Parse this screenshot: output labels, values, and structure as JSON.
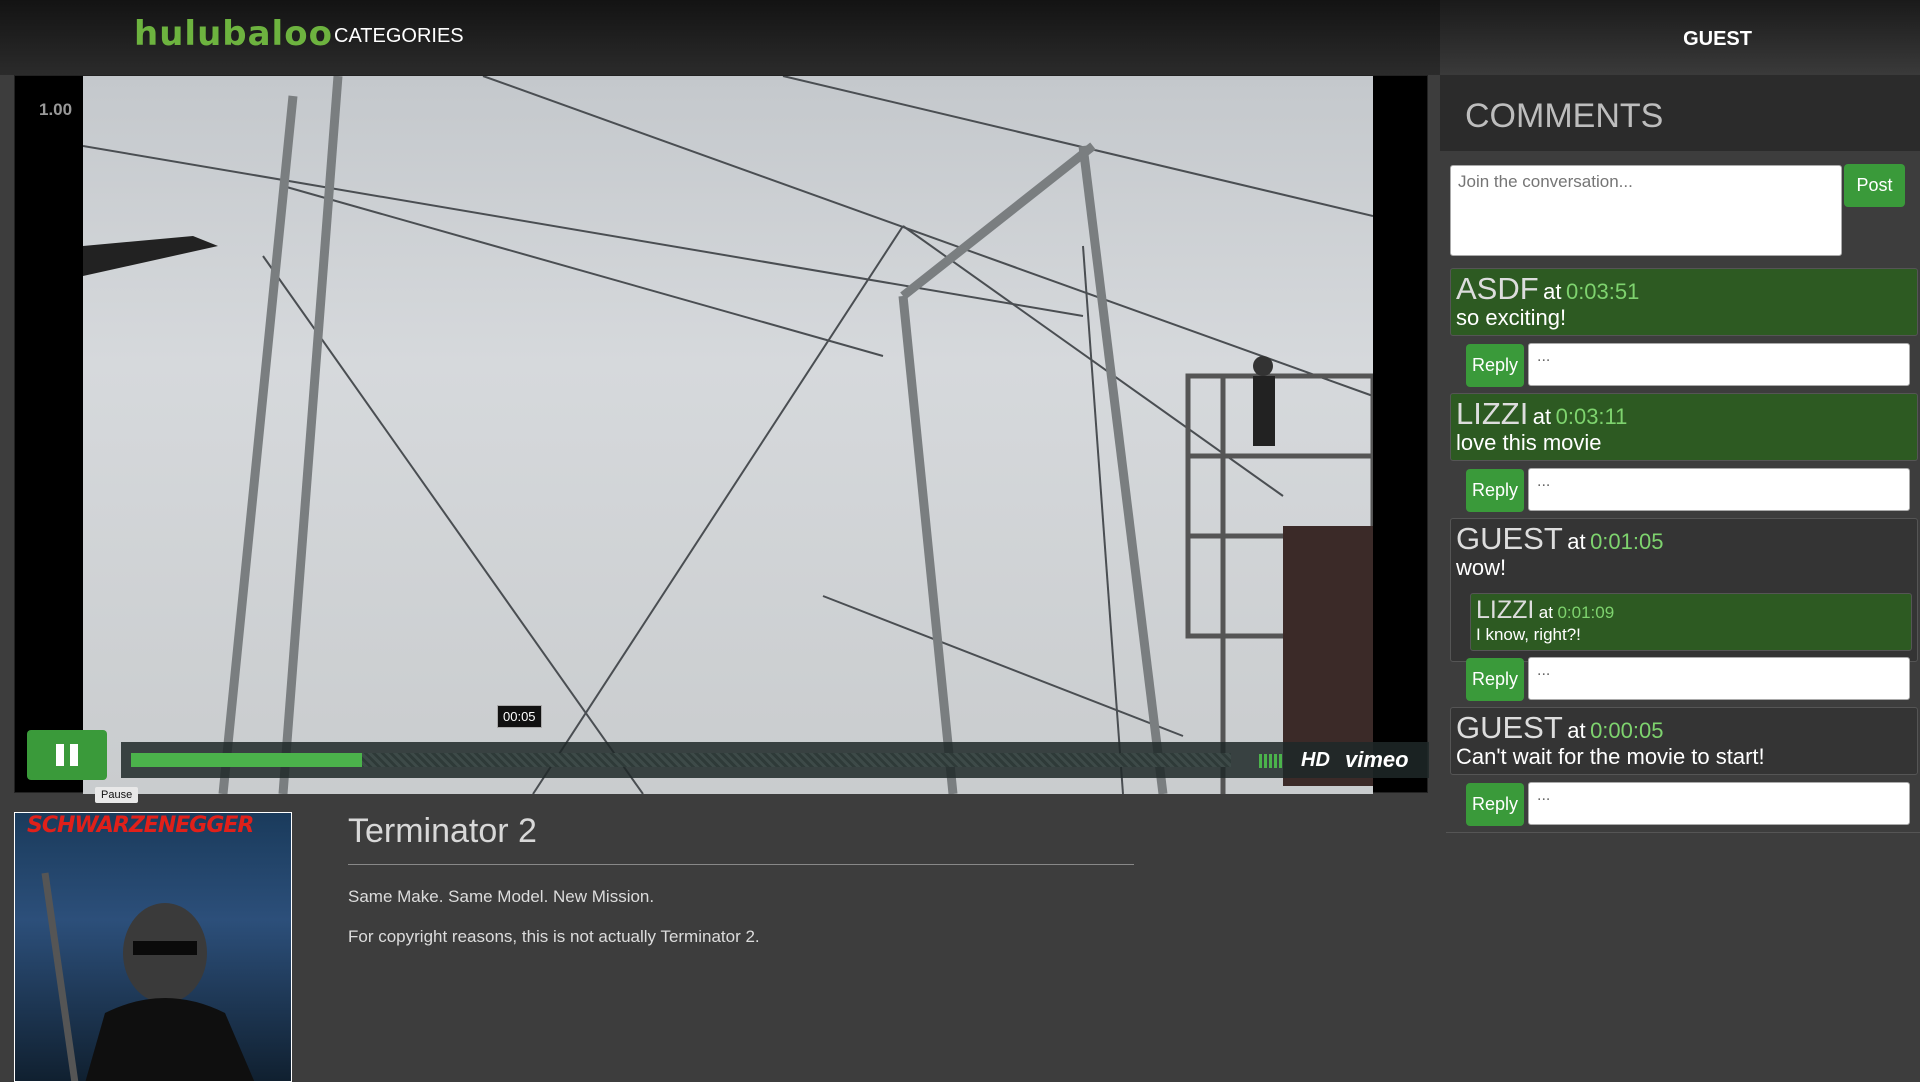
{
  "header": {
    "logo": "hulubaloo",
    "categories_label": "CATEGORIES",
    "user_label": "GUEST"
  },
  "player": {
    "speed": "1.00",
    "current_time": "00:05",
    "progress_fraction": 0.21,
    "pause_tooltip": "Pause",
    "hd_label": "HD",
    "brand_label": "vimeo"
  },
  "movie": {
    "poster_title": "SCHWARZENEGGER",
    "title": "Terminator 2",
    "tagline": "Same Make. Same Model. New Mission.",
    "disclaimer": "For copyright reasons, this is not actually Terminator 2."
  },
  "comments": {
    "heading": "COMMENTS",
    "new_placeholder": "Join the conversation...",
    "post_label": "Post",
    "reply_label": "Reply",
    "reply_placeholder": "...",
    "at_word": "at",
    "items": [
      {
        "author": "ASDF",
        "time": "0:03:51",
        "text": "so exciting!"
      },
      {
        "author": "LIZZI",
        "time": "0:03:11",
        "text": "love this movie"
      },
      {
        "author": "GUEST",
        "time": "0:01:05",
        "text": "wow!",
        "replies": [
          {
            "author": "LIZZI",
            "time": "0:01:09",
            "text": "I know, right?!"
          }
        ]
      },
      {
        "author": "GUEST",
        "time": "0:00:05",
        "text": "Can't wait for the movie to start!"
      }
    ]
  },
  "colors": {
    "accent_green": "#3a9a3a",
    "time_green": "#7ed36e",
    "logo_green": "#6db33f"
  }
}
